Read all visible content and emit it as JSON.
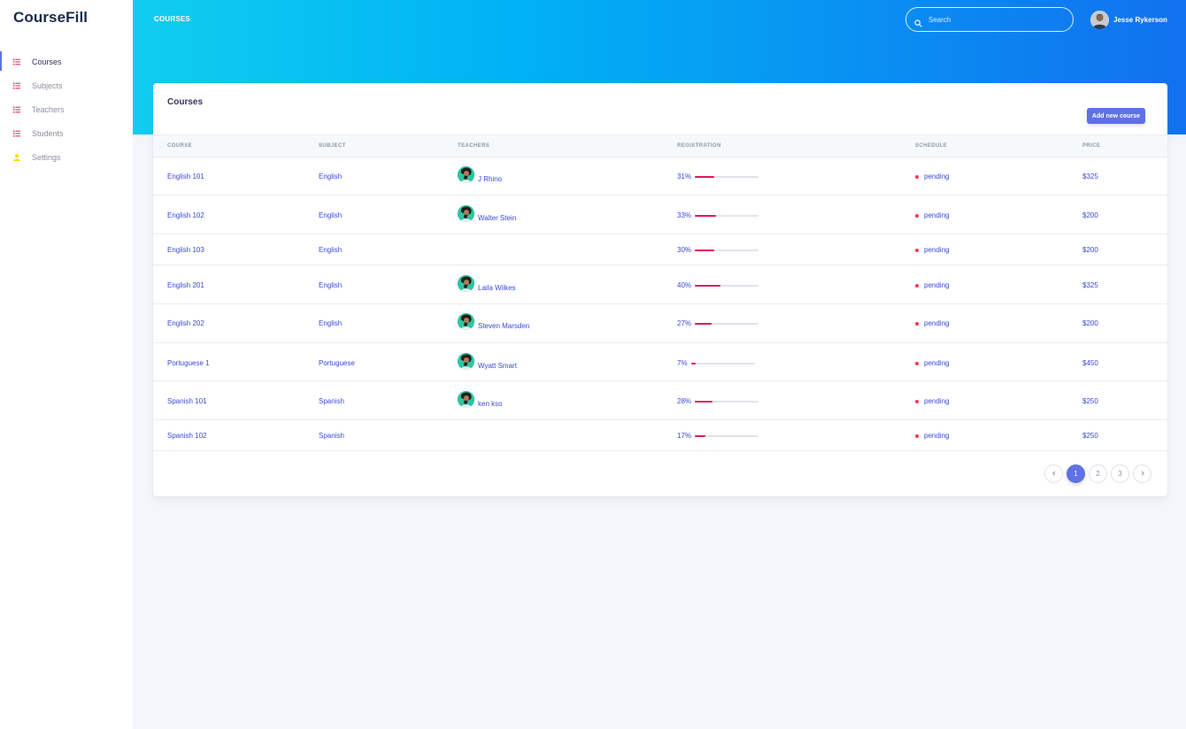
{
  "brand": "CourseFill",
  "sidebar": {
    "items": [
      {
        "label": "Courses",
        "icon": "list-icon",
        "active": true
      },
      {
        "label": "Subjects",
        "icon": "list-icon",
        "active": false
      },
      {
        "label": "Teachers",
        "icon": "list-icon",
        "active": false
      },
      {
        "label": "Students",
        "icon": "list-icon",
        "active": false
      },
      {
        "label": "Settings",
        "icon": "user-icon",
        "active": false
      }
    ]
  },
  "header": {
    "title": "COURSES",
    "search_placeholder": "Search",
    "user_name": "Jesse Rykerson"
  },
  "card": {
    "title": "Courses",
    "add_button": "Add new course",
    "columns": [
      "COURSE",
      "SUBJECT",
      "TEACHERS",
      "REGISTRATION",
      "SCHEDULE",
      "PRICE"
    ],
    "rows": [
      {
        "course": "English 101",
        "subject": "English",
        "teacher": "J Rhino",
        "registration": "31%",
        "pct": 31,
        "schedule": "pending",
        "price": "$325"
      },
      {
        "course": "English 102",
        "subject": "English",
        "teacher": "Walter Stein",
        "registration": "33%",
        "pct": 33,
        "schedule": "pending",
        "price": "$200"
      },
      {
        "course": "English 103",
        "subject": "English",
        "teacher": "",
        "registration": "30%",
        "pct": 30,
        "schedule": "pending",
        "price": "$200"
      },
      {
        "course": "English 201",
        "subject": "English",
        "teacher": "Laila Wilkes",
        "registration": "40%",
        "pct": 40,
        "schedule": "pending",
        "price": "$325"
      },
      {
        "course": "English 202",
        "subject": "English",
        "teacher": "Steven Marsden",
        "registration": "27%",
        "pct": 27,
        "schedule": "pending",
        "price": "$200"
      },
      {
        "course": "Portuguese 1",
        "subject": "Portuguese",
        "teacher": "Wyatt Smart",
        "registration": "7%",
        "pct": 7,
        "schedule": "pending",
        "price": "$450"
      },
      {
        "course": "Spanish 101",
        "subject": "Spanish",
        "teacher": "ken kso",
        "registration": "28%",
        "pct": 28,
        "schedule": "pending",
        "price": "$250"
      },
      {
        "course": "Spanish 102",
        "subject": "Spanish",
        "teacher": "",
        "registration": "17%",
        "pct": 17,
        "schedule": "pending",
        "price": "$250"
      }
    ]
  },
  "pagination": {
    "prev_icon": "chevron-left-icon",
    "pages": [
      "1",
      "2",
      "3"
    ],
    "current": "1",
    "next_icon": "chevron-right-icon"
  },
  "colors": {
    "accent": "#5e72e4",
    "progress": "#e4155c",
    "status_pending": "#f5365c",
    "link": "#3948d8"
  }
}
